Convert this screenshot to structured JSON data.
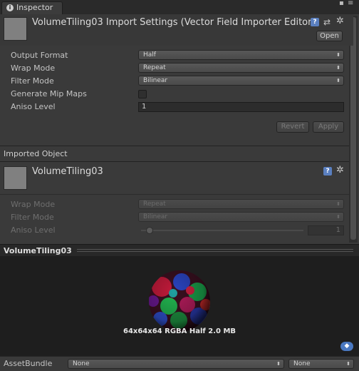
{
  "window": {
    "tab_label": "Inspector",
    "tab_icon": "info-icon",
    "menu_icon": "window-menu-icon",
    "lock_icon": "lock-icon"
  },
  "importer": {
    "title": "VolumeTiling03 Import Settings (Vector Field Importer Editor)",
    "open_button": "Open",
    "fields": {
      "output_format_label": "Output Format",
      "output_format_value": "Half",
      "wrap_mode_label": "Wrap Mode",
      "wrap_mode_value": "Repeat",
      "filter_mode_label": "Filter Mode",
      "filter_mode_value": "Bilinear",
      "mipmaps_label": "Generate Mip Maps",
      "aniso_label": "Aniso Level",
      "aniso_value": "1"
    },
    "revert_button": "Revert",
    "apply_button": "Apply"
  },
  "imported": {
    "section_title": "Imported Object",
    "object_title": "VolumeTiling03",
    "fields": {
      "wrap_mode_label": "Wrap Mode",
      "wrap_mode_value": "Repeat",
      "filter_mode_label": "Filter Mode",
      "filter_mode_value": "Bilinear",
      "aniso_label": "Aniso Level",
      "aniso_value": "1"
    }
  },
  "preview": {
    "title": "VolumeTiling03",
    "info": "64x64x64 RGBA Half 2.0 MB",
    "asset_bundle_label": "AssetBundle",
    "asset_bundle_value": "None",
    "variant_value": "None"
  },
  "colors": {
    "panel": "#3a3a3a",
    "preview_bg": "#1e1e1e",
    "help_blue": "#5a7fbf"
  }
}
